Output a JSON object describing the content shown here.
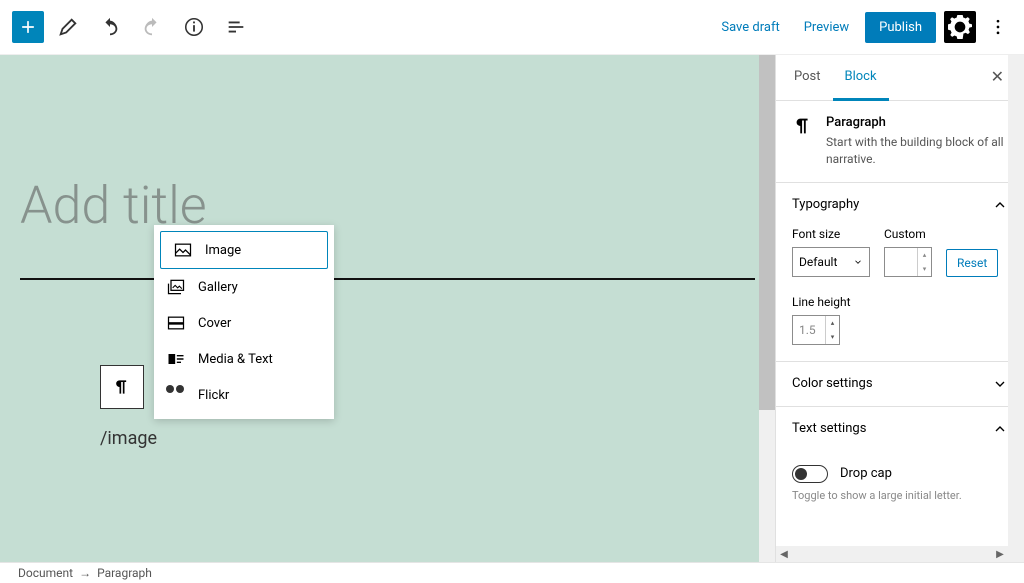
{
  "toolbar": {
    "save_draft": "Save draft",
    "preview": "Preview",
    "publish": "Publish"
  },
  "canvas": {
    "title_placeholder": "Add title",
    "slash_input": "/image"
  },
  "autocomplete": {
    "items": [
      {
        "label": "Image",
        "icon": "image-icon",
        "selected": true
      },
      {
        "label": "Gallery",
        "icon": "gallery-icon",
        "selected": false
      },
      {
        "label": "Cover",
        "icon": "cover-icon",
        "selected": false
      },
      {
        "label": "Media & Text",
        "icon": "media-text-icon",
        "selected": false
      },
      {
        "label": "Flickr",
        "icon": "flickr-icon",
        "selected": false
      }
    ]
  },
  "sidebar": {
    "tabs": {
      "post": "Post",
      "block": "Block"
    },
    "block_name": "Paragraph",
    "block_desc": "Start with the building block of all narrative.",
    "typography": {
      "heading": "Typography",
      "font_size_label": "Font size",
      "font_size_value": "Default",
      "custom_label": "Custom",
      "reset": "Reset",
      "line_height_label": "Line height",
      "line_height_value": "1.5"
    },
    "color_heading": "Color settings",
    "text_heading": "Text settings",
    "drop_cap_label": "Drop cap",
    "drop_cap_desc": "Toggle to show a large initial letter."
  },
  "footer": {
    "crumb1": "Document",
    "crumb2": "Paragraph"
  }
}
